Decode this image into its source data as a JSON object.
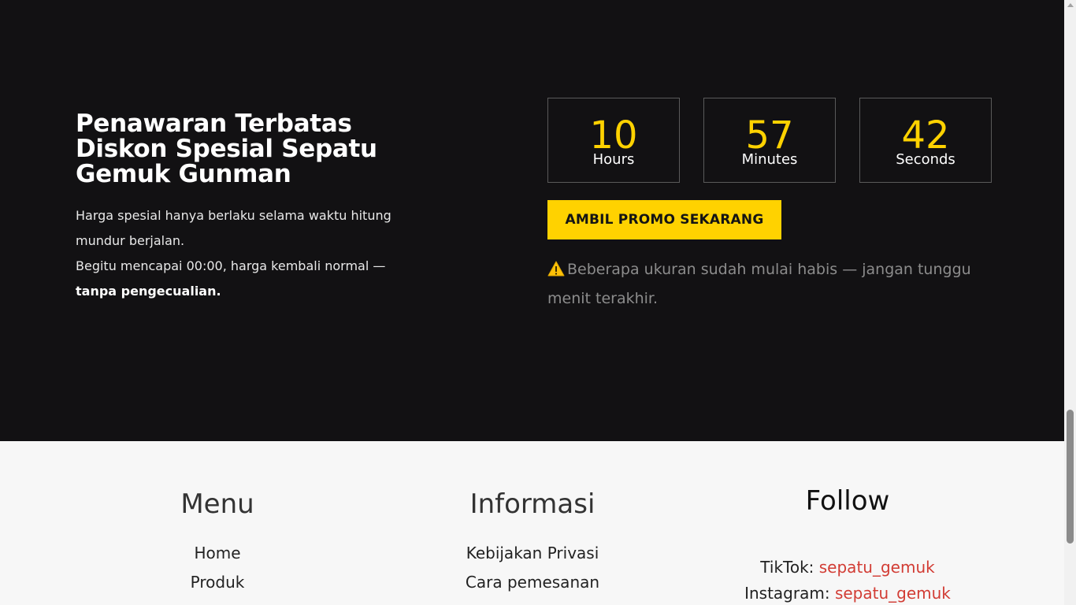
{
  "promo": {
    "title": "Penawaran Terbatas Diskon Spesial Sepatu Gemuk Gunman",
    "desc_line1": "Harga spesial hanya berlaku selama waktu hitung mundur berjalan.",
    "desc_line2_prefix": "Begitu mencapai 00:00, harga kembali normal — ",
    "desc_line2_bold": "tanpa pengecualian.",
    "countdown": [
      {
        "value": "10",
        "label": "Hours"
      },
      {
        "value": "57",
        "label": "Minutes"
      },
      {
        "value": "42",
        "label": "Seconds"
      }
    ],
    "cta_label": "AMBIL PROMO SEKARANG",
    "warning_text": "Beberapa ukuran sudah mulai habis — jangan tunggu menit terakhir.",
    "warning_icon": "warning-icon",
    "accent_color": "#ffd200",
    "background_color": "#121113"
  },
  "footer": {
    "menu": {
      "heading": "Menu",
      "items": [
        "Home",
        "Produk"
      ]
    },
    "info": {
      "heading": "Informasi",
      "items": [
        "Kebijakan Privasi",
        "Cara pemesanan"
      ]
    },
    "follow": {
      "heading": "Follow",
      "tiktok_label": "TikTok:",
      "tiktok_handle": "sepatu_gemuk",
      "instagram_label": "Instagram:",
      "instagram_handle": "sepatu_gemuk",
      "link_color": "#d23c34"
    },
    "background_color": "#f7f7f7"
  }
}
